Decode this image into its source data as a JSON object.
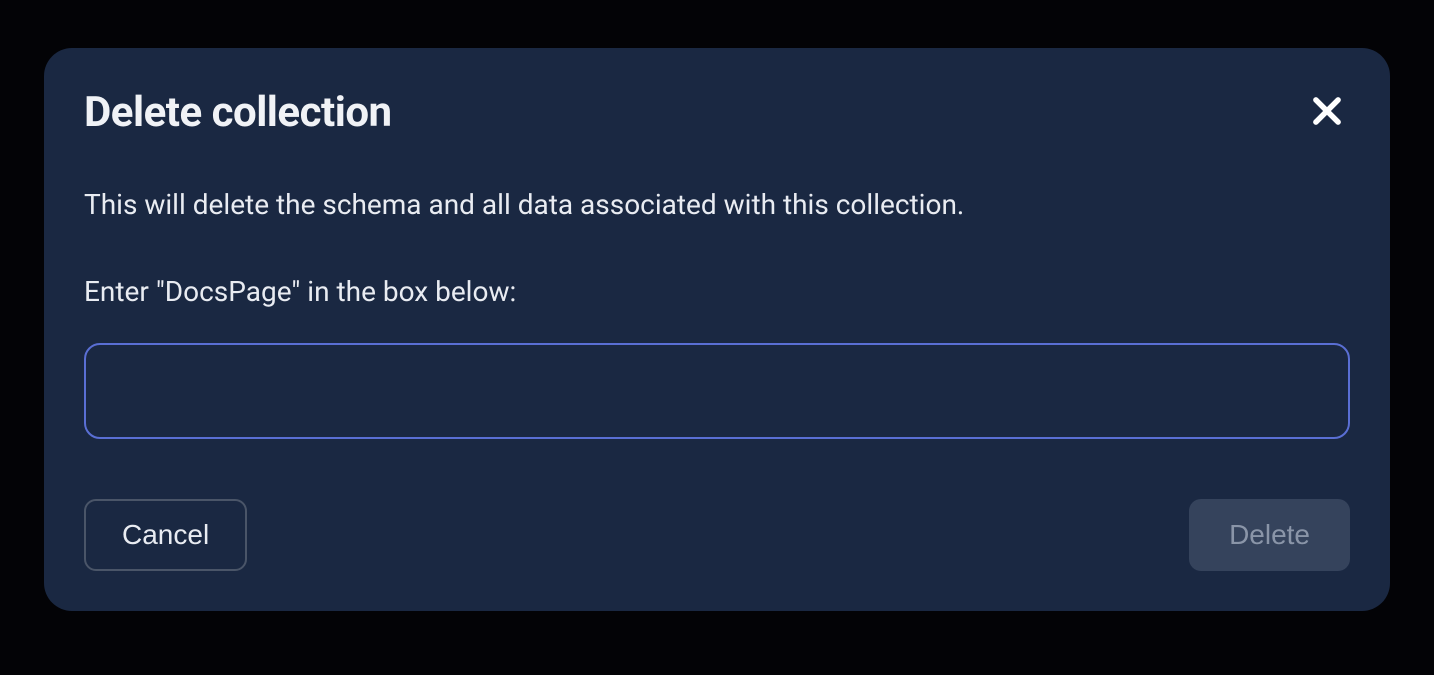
{
  "dialog": {
    "title": "Delete collection",
    "warning": "This will delete the schema and all data associated with this collection.",
    "prompt": "Enter \"DocsPage\" in the box below:",
    "input_value": "",
    "cancel_label": "Cancel",
    "delete_label": "Delete"
  }
}
